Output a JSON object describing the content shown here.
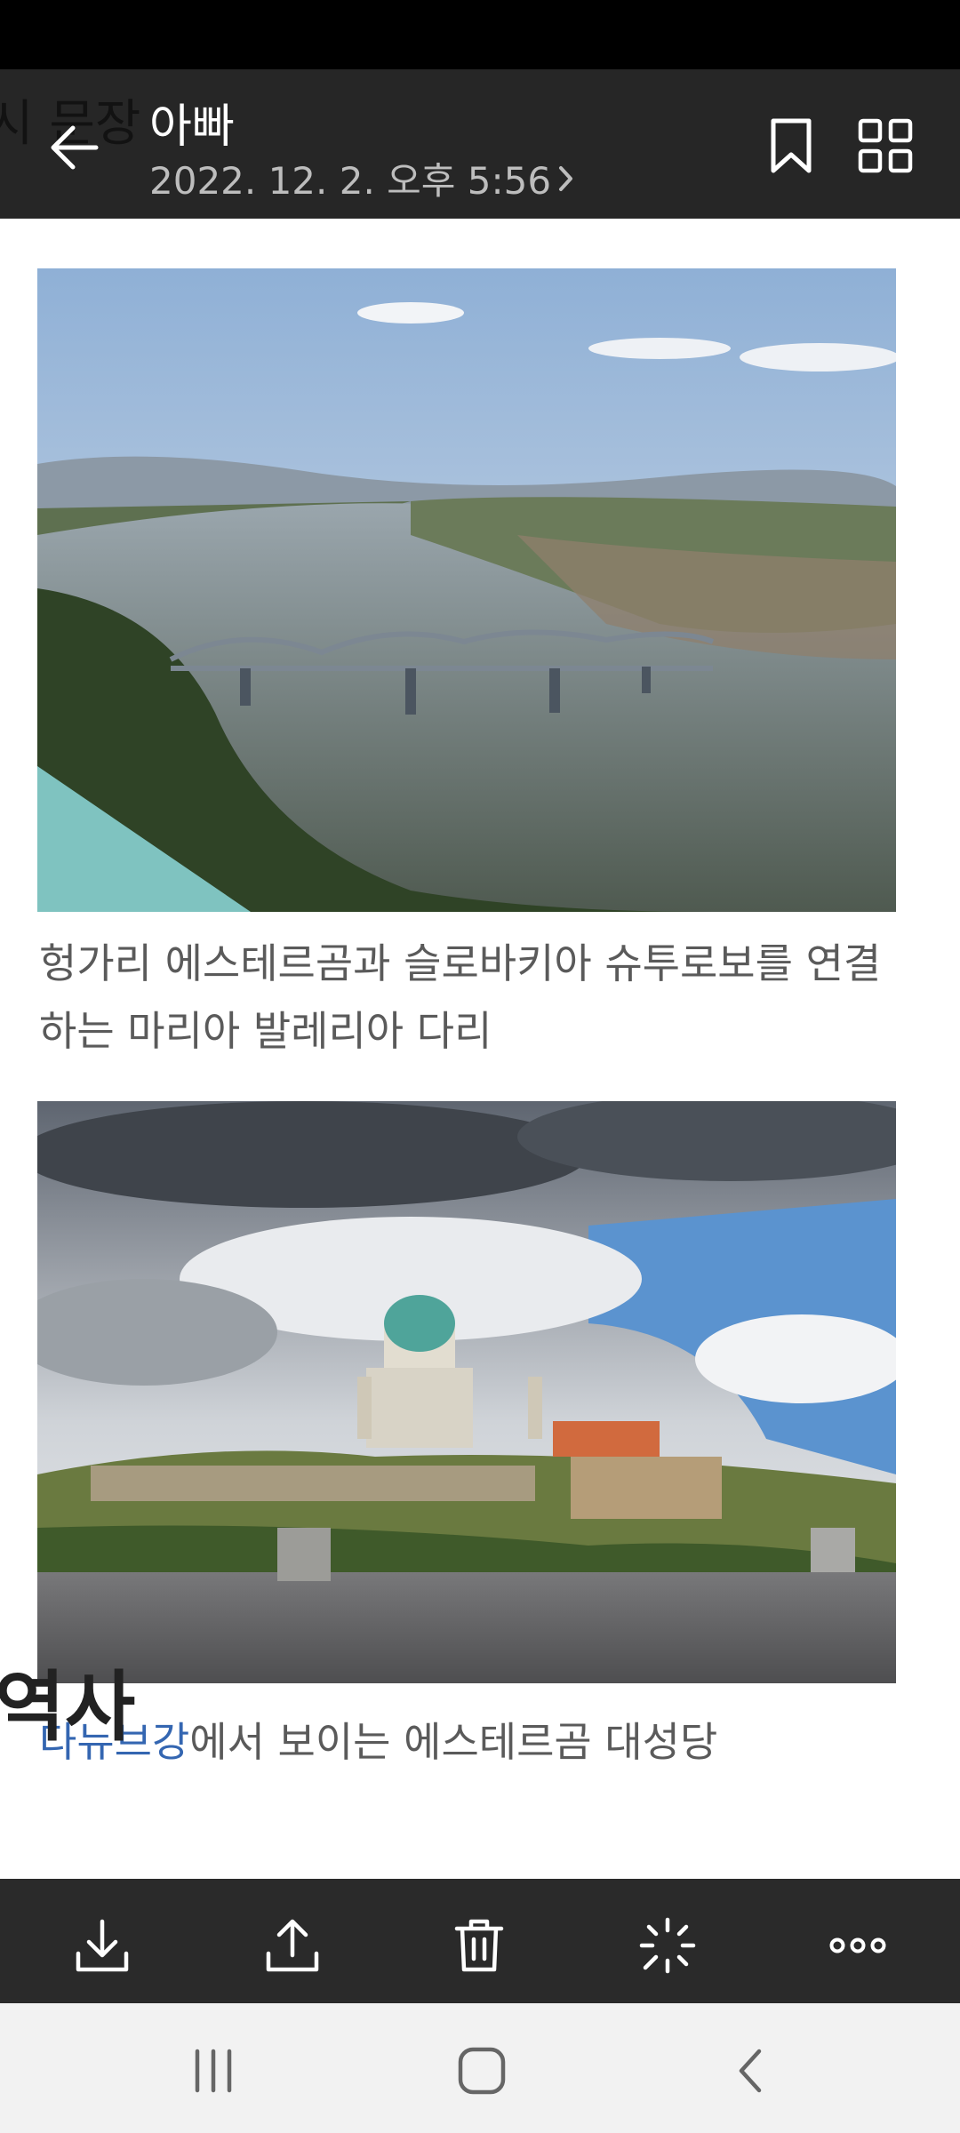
{
  "header": {
    "ghost_text": "시 문장",
    "title": "아빠",
    "date": "2022. 12. 2. 오후 5:56"
  },
  "content": {
    "photos": [
      {
        "name": "river-bridge-photo",
        "description_icon": "image"
      },
      {
        "name": "basilica-photo",
        "description_icon": "image"
      }
    ],
    "caption1": "헝가리 에스테르곰과 슬로바키아 슈투로보를 연결하는 마리아 발레리아 다리",
    "caption2_link": "다뉴브강",
    "caption2_rest": "에서 보이는 에스테르곰 대성당",
    "section_heading": "역사"
  },
  "toolbar": {
    "icons": [
      "download-icon",
      "share-icon",
      "delete-icon",
      "remaster-icon",
      "more-icon"
    ]
  },
  "nav": {
    "icons": [
      "recents-icon",
      "home-icon",
      "back-icon"
    ]
  },
  "colors": {
    "top_bar": "#262626",
    "toolbar": "#2a2a2a",
    "link": "#3466b1",
    "navbar": "#f2f2f2"
  }
}
